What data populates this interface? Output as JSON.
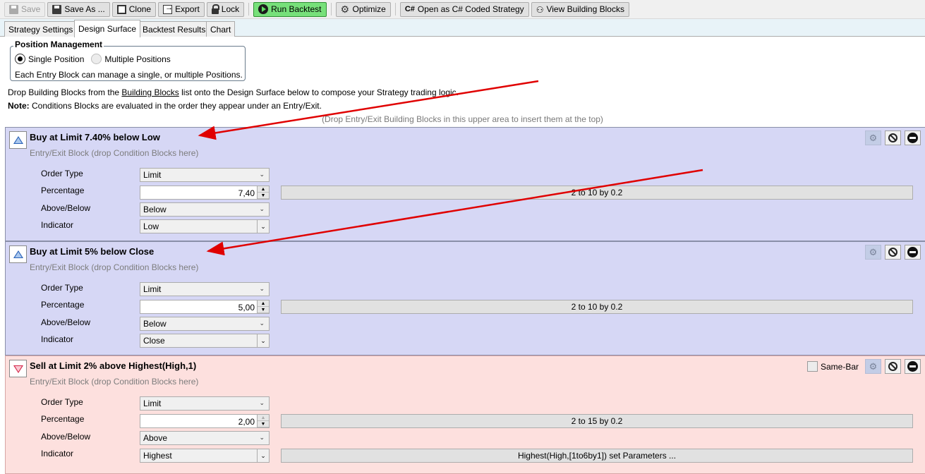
{
  "toolbar": {
    "save": "Save",
    "save_as": "Save As ...",
    "clone": "Clone",
    "export": "Export",
    "lock": "Lock",
    "run_backtest": "Run Backtest",
    "optimize": "Optimize",
    "open_coded": "Open as C# Coded Strategy",
    "view_blocks": "View Building Blocks",
    "csharp_glyph": "C#"
  },
  "tabs": [
    "Strategy Settings",
    "Design Surface",
    "Backtest Results",
    "Chart"
  ],
  "active_tab": "Design Surface",
  "position_management": {
    "title": "Position Management",
    "option_single": "Single Position",
    "option_multiple": "Multiple Positions",
    "selected": "Single Position",
    "note": "Each Entry Block can manage a single, or multiple Positions."
  },
  "info": {
    "line1_pre": "Drop Building Blocks from the ",
    "line1_link": "Building Blocks",
    "line1_post": " list onto the Design Surface below to compose your Strategy trading logic.",
    "line2_bold": "Note:",
    "line2_text": " Conditions Blocks are evaluated in the order they appear under an Entry/Exit.",
    "drop_hint": "(Drop Entry/Exit Building Blocks in this upper area to insert them at the top)"
  },
  "labels": {
    "order_type": "Order Type",
    "percentage": "Percentage",
    "above_below": "Above/Below",
    "indicator": "Indicator",
    "subtitle": "Entry/Exit Block (drop Condition Blocks here)",
    "same_bar": "Same-Bar"
  },
  "blocks": [
    {
      "title": "Buy at Limit 7.40% below Low",
      "order_type": "Limit",
      "percentage": "7,40",
      "percentage_range": "2 to 10 by 0.2",
      "above_below": "Below",
      "indicator": "Low"
    },
    {
      "title": "Buy at Limit 5% below Close",
      "order_type": "Limit",
      "percentage": "5,00",
      "percentage_range": "2 to 10 by 0.2",
      "above_below": "Below",
      "indicator": "Close"
    },
    {
      "title": "Sell at Limit 2% above Highest(High,1)",
      "order_type": "Limit",
      "percentage": "2,00",
      "percentage_range": "2 to 15 by 0.2",
      "above_below": "Above",
      "indicator": "Highest",
      "indicator_params": "Highest(High,[1to6by1]) set Parameters ..."
    }
  ],
  "colors": {
    "buy_block": "#d6d7f5",
    "sell_block": "#fde0de",
    "run_button": "#77e07a",
    "annotation_arrow": "#e00000"
  }
}
